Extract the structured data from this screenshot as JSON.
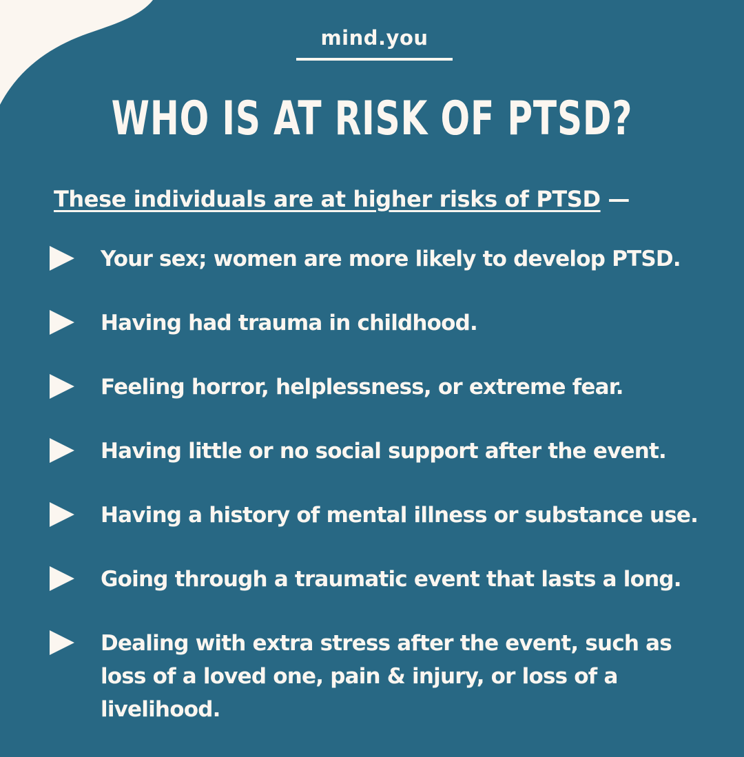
{
  "brand": {
    "name": "mind.you"
  },
  "header": {
    "title": "WHO IS AT RISK OF PTSD?"
  },
  "intro": {
    "text": "These individuals are at higher risks of PTSD",
    "dash": " —"
  },
  "risk_factors": [
    "Your sex; women are more likely to develop PTSD.",
    "Having had trauma in childhood.",
    "Feeling horror, helplessness, or extreme fear.",
    "Having little or no social support after the event.",
    "Having a history of mental illness or substance use.",
    "Going through a traumatic event that lasts a long.",
    "Dealing with extra stress after the event, such as loss of a loved one, pain & injury, or loss of a livelihood."
  ],
  "icons": {
    "bullet": "triangle-right-icon"
  },
  "colors": {
    "background": "#286884",
    "cream": "#fbf6f0"
  }
}
